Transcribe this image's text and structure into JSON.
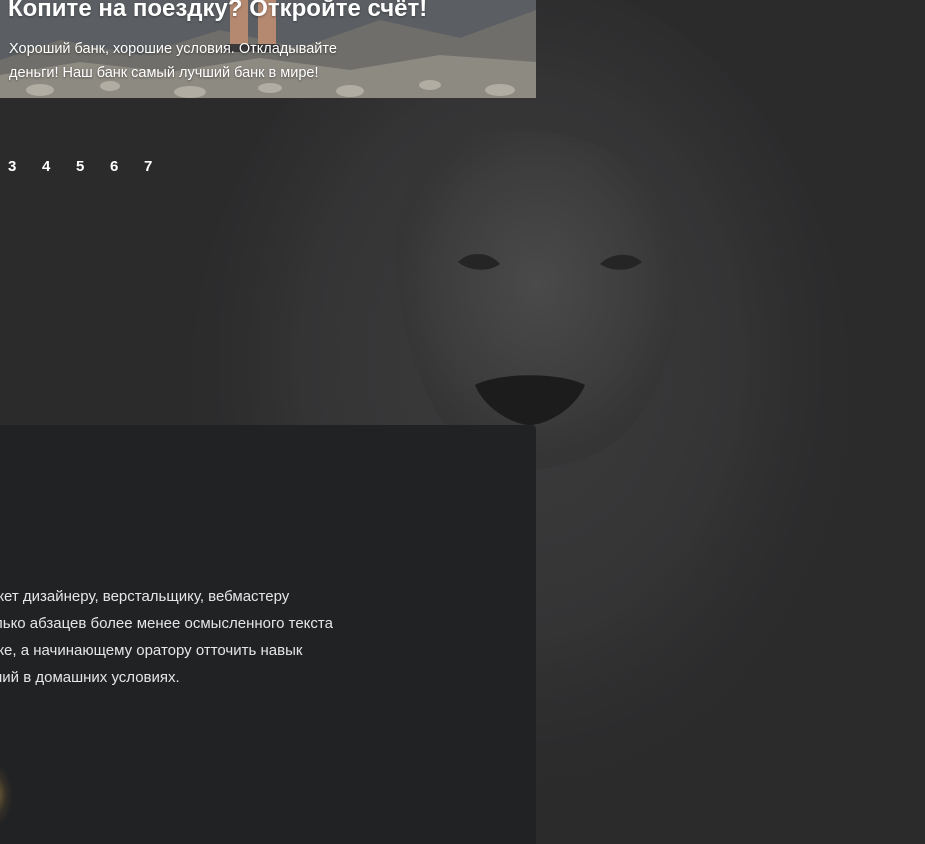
{
  "hero": {
    "title": "Копите на поездку? Откройте счёт!",
    "subtitle_line1": "Хороший банк, хорошие условия. Откладывайте",
    "subtitle_line2": "деньги! Наш банк самый лучший банк в мире!"
  },
  "pagination": {
    "pages": [
      "3",
      "4",
      "5",
      "6",
      "7"
    ]
  },
  "card": {
    "lines": [
      "жет дизайнеру, верстальщику, вебмастеру",
      "лько абзацев более менее осмысленного текста",
      "же, а начинающему оратору отточить навык",
      "ний в домашних условиях."
    ]
  },
  "colors": {
    "page_background": "#2b2b2c",
    "card_background": "#212224",
    "text": "#ffffff"
  },
  "icons": {
    "background": "lion-photo"
  }
}
